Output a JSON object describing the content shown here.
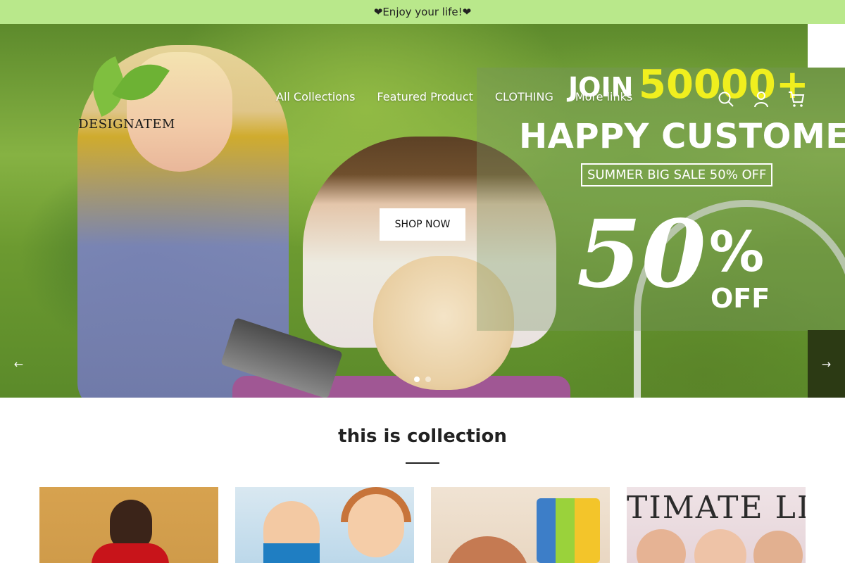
{
  "announcement": "❤Enjoy your life!❤",
  "brand": {
    "logo_text": "DESIGNATEM"
  },
  "nav": {
    "items": [
      {
        "label": "All Collections"
      },
      {
        "label": "Featured Product"
      },
      {
        "label": "CLOTHING"
      },
      {
        "label": "More links"
      }
    ],
    "icons": [
      "search-icon",
      "account-icon",
      "cart-icon"
    ]
  },
  "hero": {
    "promo": {
      "join": "JOIN",
      "number": "50000+",
      "headline": "HAPPY CUSTOMERS",
      "sale": "SUMMER BIG SALE 50% OFF",
      "big_number": "50",
      "percent": "%",
      "off": "OFF"
    },
    "cta_label": "SHOP NOW",
    "slide_dots": 2,
    "active_slide": 1,
    "prev_arrow": "←",
    "next_arrow": "→"
  },
  "collection": {
    "title": "this is collection",
    "cards": [
      {
        "overlay_text": ""
      },
      {
        "overlay_text": ""
      },
      {
        "overlay_text": ""
      },
      {
        "overlay_text": "TIMATE LI"
      }
    ]
  },
  "colors": {
    "announcement_bg": "#b9e88b",
    "promo_yellow": "#f0ef1e",
    "arrow_bg": "#2c3a14"
  }
}
